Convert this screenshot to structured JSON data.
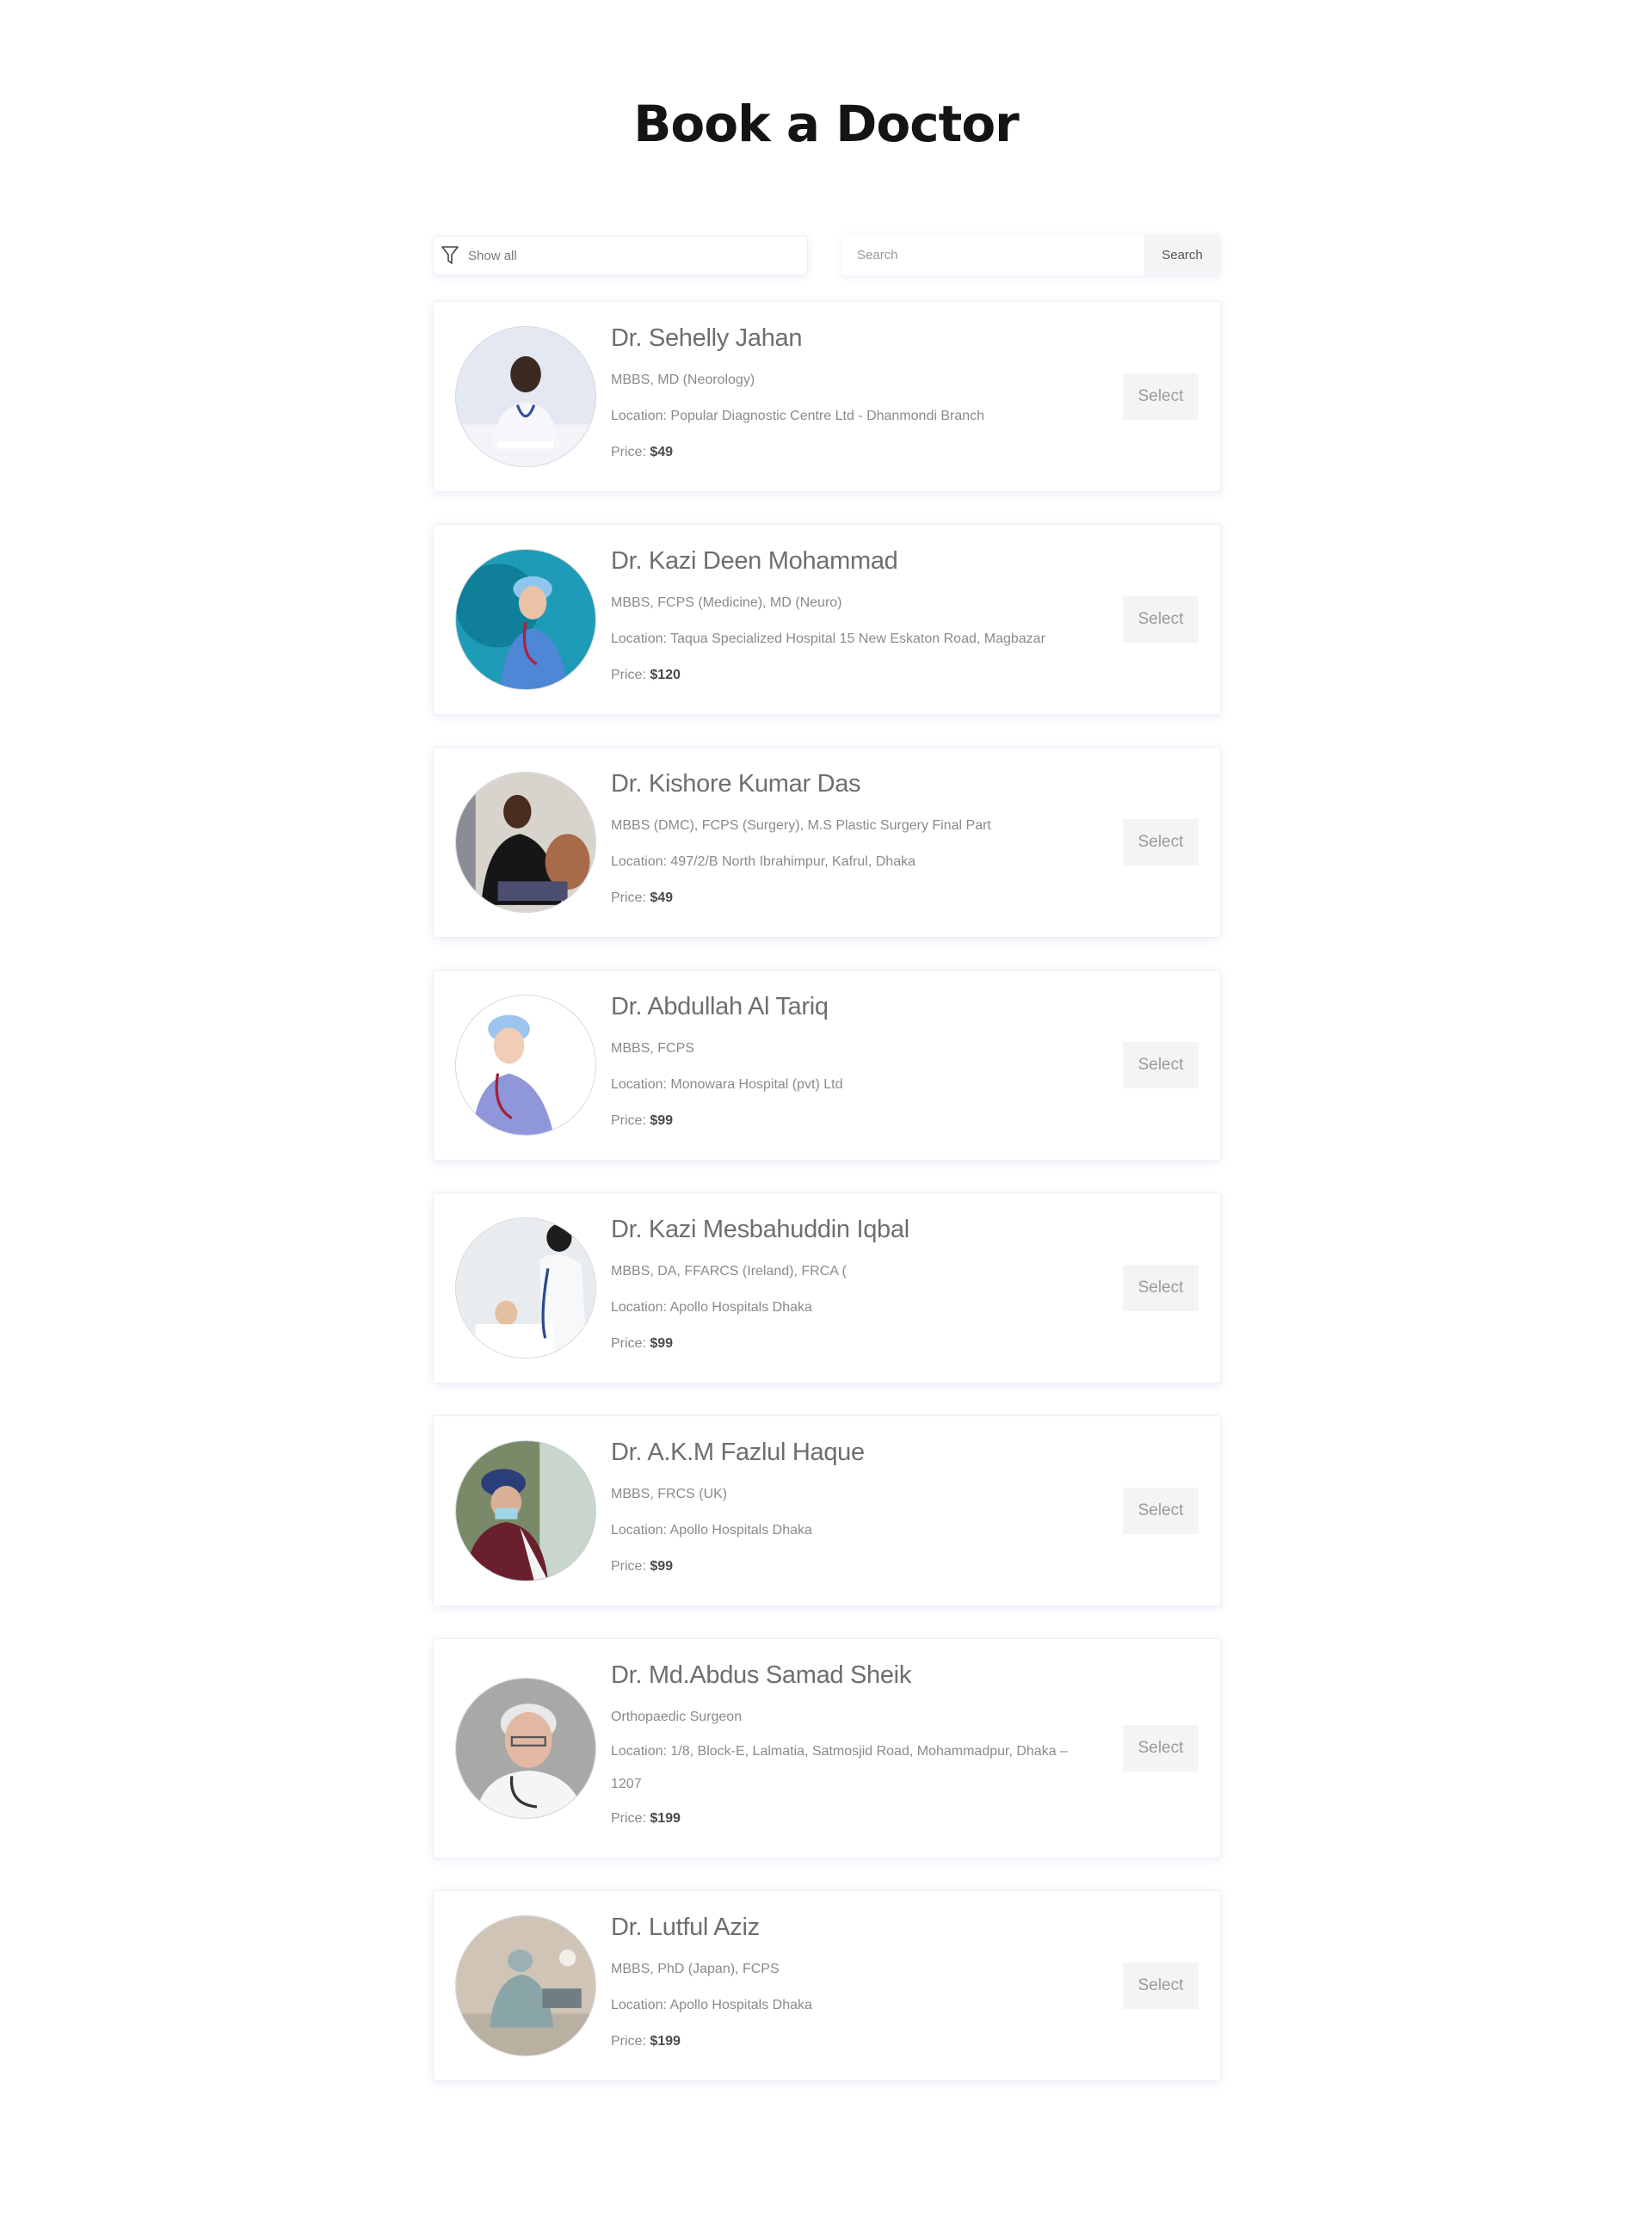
{
  "page": {
    "title": "Book a Doctor"
  },
  "filter": {
    "label": "Show all",
    "icon": "funnel-icon"
  },
  "search": {
    "placeholder": "Search",
    "value": "",
    "button_label": "Search"
  },
  "labels": {
    "location_prefix": "Location: ",
    "price_prefix": "Price: ",
    "select_label": "Select"
  },
  "doctors": [
    {
      "name": "Dr. Sehelly Jahan",
      "qualifications": "MBBS, MD (Neorology)",
      "location": "Popular Diagnostic Centre Ltd - Dhanmondi Branch",
      "price": "$49"
    },
    {
      "name": "Dr. Kazi Deen Mohammad",
      "qualifications": "MBBS, FCPS (Medicine), MD (Neuro)",
      "location": "Taqua Specialized Hospital 15 New Eskaton Road, Magbazar",
      "price": "$120"
    },
    {
      "name": "Dr. Kishore Kumar Das",
      "qualifications": "MBBS (DMC), FCPS (Surgery), M.S Plastic Surgery Final Part",
      "location": "497/2/B North Ibrahimpur, Kafrul, Dhaka",
      "price": "$49"
    },
    {
      "name": "Dr. Abdullah Al Tariq",
      "qualifications": "MBBS, FCPS",
      "location": "Monowara Hospital (pvt) Ltd",
      "price": "$99"
    },
    {
      "name": "Dr. Kazi Mesbahuddin Iqbal",
      "qualifications": "MBBS, DA, FFARCS (Ireland), FRCA (",
      "location": "Apollo Hospitals Dhaka",
      "price": "$99"
    },
    {
      "name": "Dr. A.K.M Fazlul Haque",
      "qualifications": "MBBS, FRCS (UK)",
      "location": "Apollo Hospitals Dhaka",
      "price": "$99"
    },
    {
      "name": "Dr. Md.Abdus Samad Sheik",
      "qualifications": "Orthopaedic Surgeon",
      "location": "1/8, Block-E, Lalmatia, Satmosjid Road, Mohammadpur, Dhaka – 1207",
      "price": "$199"
    },
    {
      "name": "Dr. Lutful Aziz",
      "qualifications": "MBBS, PhD (Japan), FCPS",
      "location": "Apollo Hospitals Dhaka",
      "price": "$199"
    }
  ]
}
